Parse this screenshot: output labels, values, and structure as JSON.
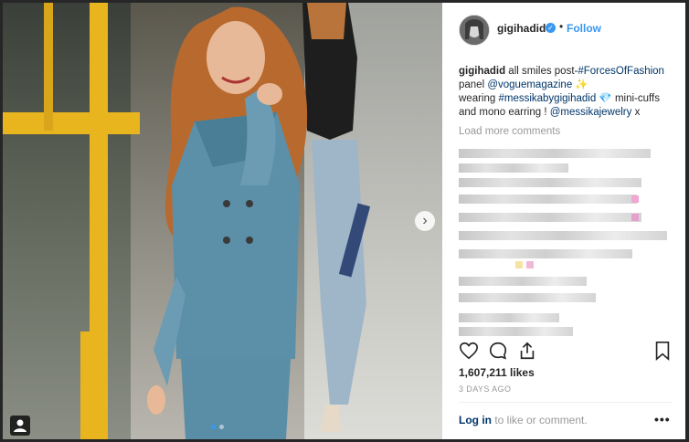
{
  "post": {
    "username": "gigihadid",
    "follow_label": "Follow",
    "separator": "•",
    "caption": {
      "user": "gigihadid",
      "part1": " all smiles post-",
      "hashtag1": "#ForcesOfFashion",
      "part2": " panel ",
      "mention1": "@voguemagazine",
      "sparkle": " ✨",
      "part3": " wearing ",
      "hashtag2": "#messikabygigihadid",
      "gem": " 💎",
      "part4": " mini-cuffs and mono earring ! ",
      "mention2": "@messikajewelry",
      "part5": " x"
    },
    "load_more": "Load more comments",
    "likes": "1,607,211 likes",
    "time": "3 DAYS AGO",
    "login_link": "Log in",
    "login_text": " to like or comment.",
    "more_label": "•••"
  },
  "colors": {
    "accent": "#3897f0",
    "link": "#003569",
    "rail": "#e9b51f"
  },
  "icons": [
    "heart-icon",
    "comment-icon",
    "share-icon",
    "bookmark-icon",
    "verified-icon",
    "chevron-right-icon",
    "user-tag-icon"
  ]
}
